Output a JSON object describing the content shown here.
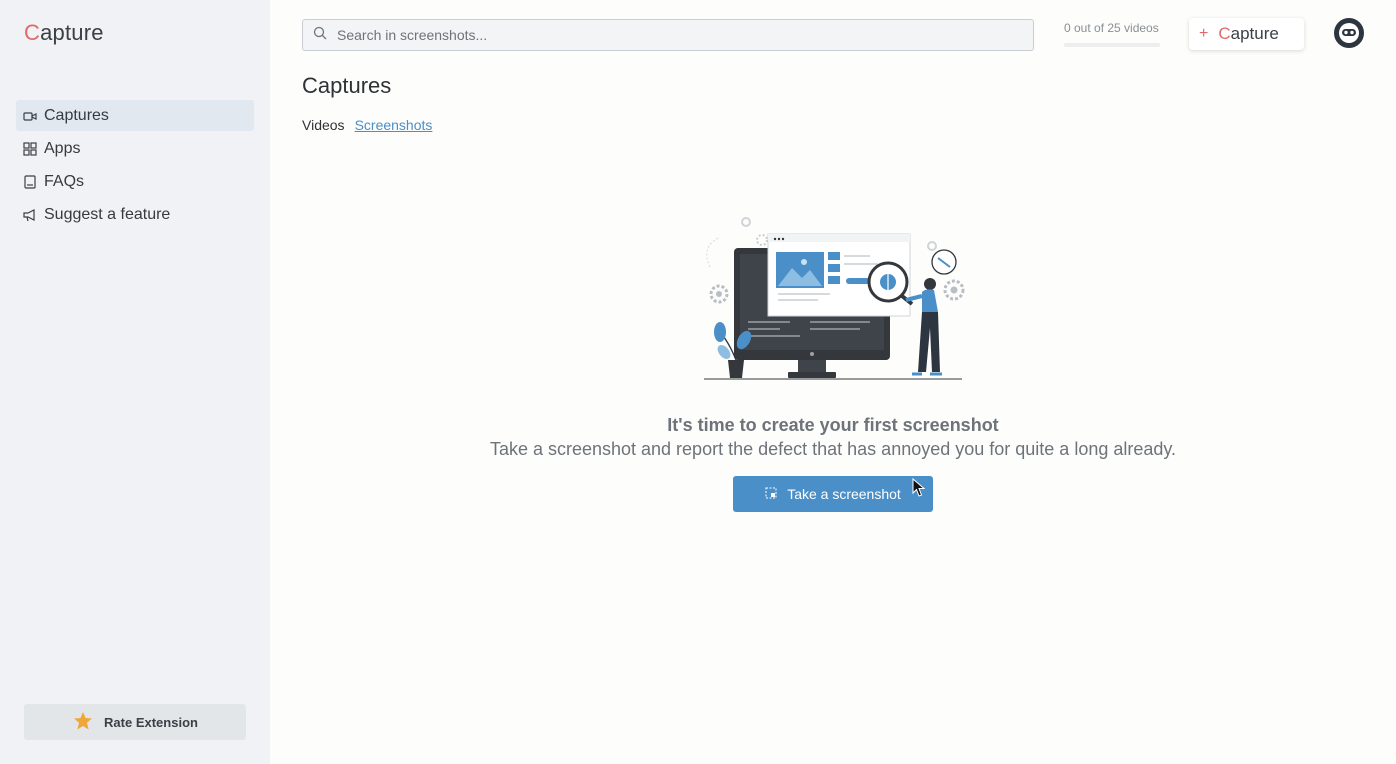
{
  "app": {
    "logo_text_first": "C",
    "logo_text_rest": "apture",
    "accent_color": "#e06a6a",
    "primary_color": "#4a8fc7"
  },
  "sidebar": {
    "items": [
      {
        "label": "Captures",
        "icon": "video-camera-icon",
        "active": true
      },
      {
        "label": "Apps",
        "icon": "apps-grid-icon",
        "active": false
      },
      {
        "label": "FAQs",
        "icon": "book-icon",
        "active": false
      },
      {
        "label": "Suggest a feature",
        "icon": "megaphone-icon",
        "active": false
      }
    ],
    "rate_label": "Rate Extension"
  },
  "header": {
    "search_placeholder": "Search in screenshots...",
    "quota_text": "0 out of 25 videos",
    "quota_fraction": 0,
    "capture_button_first": "C",
    "capture_button_rest": "apture"
  },
  "main": {
    "title": "Captures",
    "tabs": [
      {
        "label": "Videos",
        "active": false
      },
      {
        "label": "Screenshots",
        "active": true
      }
    ],
    "empty_title": "It's time to create your first screenshot",
    "empty_subtitle": "Take a screenshot and report the defect that has annoyed you for quite a long already.",
    "cta_label": "Take a screenshot"
  }
}
